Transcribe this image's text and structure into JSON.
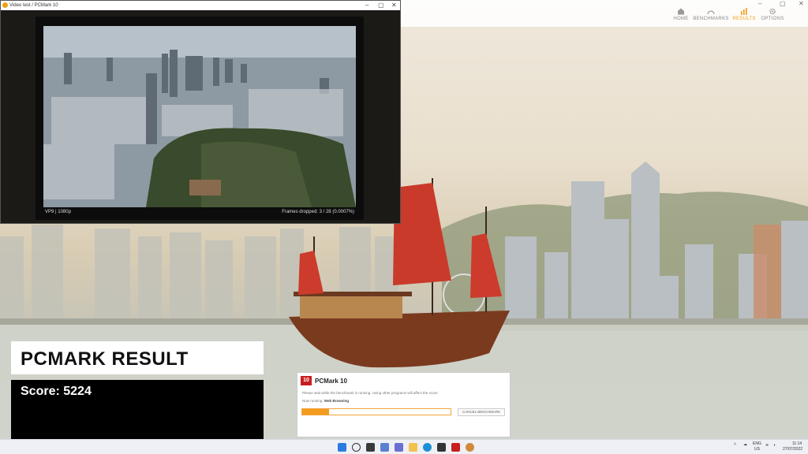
{
  "video_window": {
    "title": "Video test / PCMark 10",
    "codec_label": "VP9 | 1080p",
    "frames_dropped": "Frames dropped: 3 / 28 (0.0007%)"
  },
  "app_nav": {
    "items": [
      {
        "label": "HOME",
        "icon": "home-icon"
      },
      {
        "label": "BENCHMARKS",
        "icon": "gauge-icon"
      },
      {
        "label": "RESULTS",
        "icon": "bar-chart-icon"
      },
      {
        "label": "OPTIONS",
        "icon": "gear-icon"
      }
    ],
    "active": "RESULTS",
    "accent": "#f39c12"
  },
  "result": {
    "title": "PCMARK RESULT",
    "score": "Score: 5224"
  },
  "pcmark_dialog": {
    "app_name": "PCMark 10",
    "message": "Please wait while the benchmark is running. Using other programs will affect the score.",
    "running_prefix": "Now running:",
    "running_test": "Web Browsing",
    "progress": 0.18,
    "cancel_label": "CANCEL BENCHMARK"
  },
  "taskbar": {
    "lang_top": "ENG",
    "lang_bottom": "US",
    "time": "11:14",
    "date": "27/07/2022"
  }
}
